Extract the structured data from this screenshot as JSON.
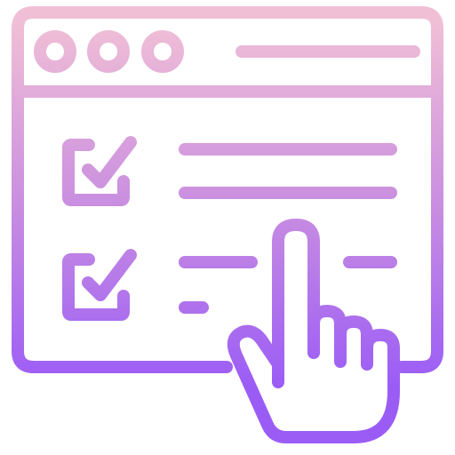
{
  "icon": {
    "name": "online-checklist-icon",
    "gradient": {
      "top_color": "#f0bfd6",
      "mid_color": "#c98ee0",
      "bottom_color": "#9b5cf6"
    },
    "checklist": {
      "items": [
        {
          "checked": true
        },
        {
          "checked": true
        }
      ]
    }
  }
}
